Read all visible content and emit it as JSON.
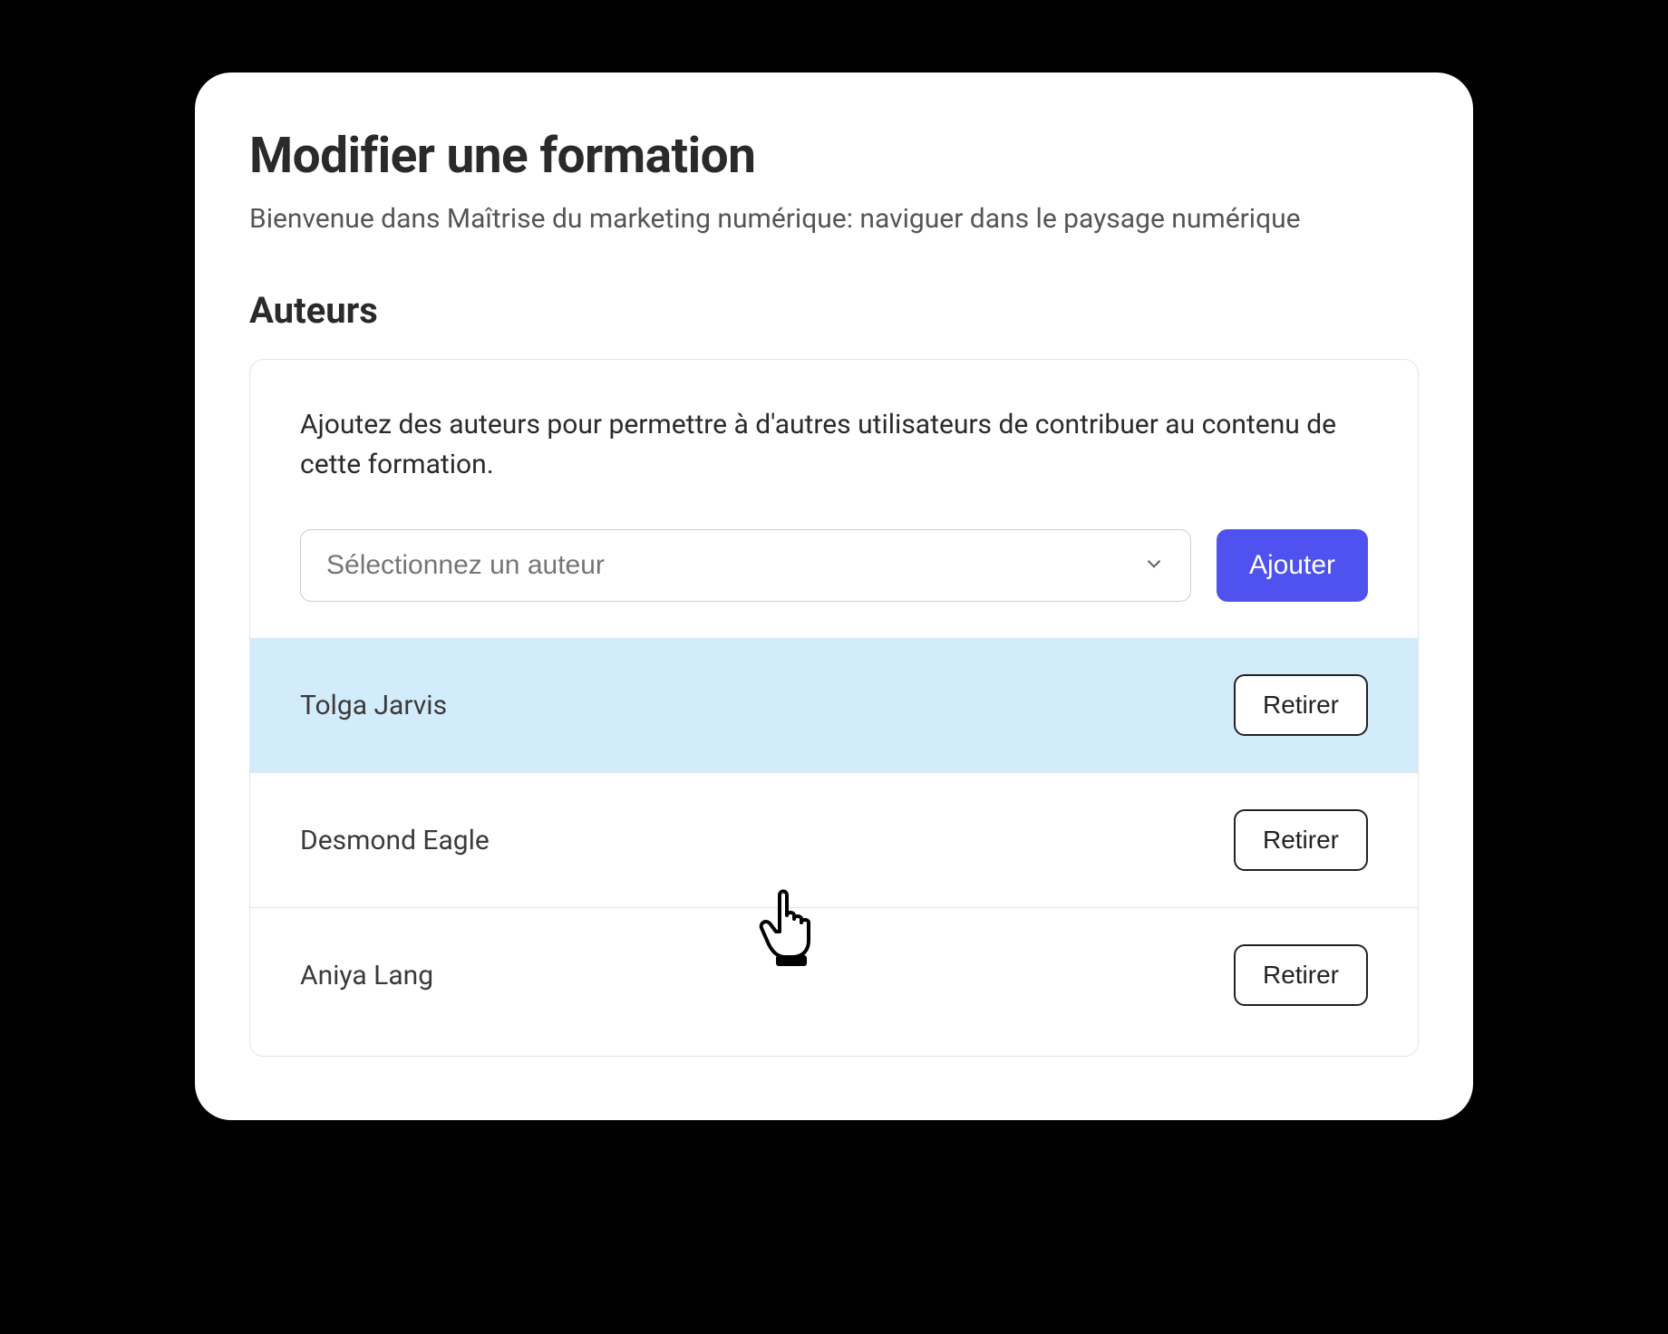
{
  "page": {
    "title": "Modifier une formation",
    "subtitle": "Bienvenue dans Maîtrise du marketing numérique: naviguer dans le paysage numérique"
  },
  "authors": {
    "section_title": "Auteurs",
    "help_text": "Ajoutez des auteurs pour permettre à d'autres utilisateurs de contribuer au contenu de cette formation.",
    "select_placeholder": "Sélectionnez un auteur",
    "add_label": "Ajouter",
    "remove_label": "Retirer",
    "list": [
      {
        "name": "Tolga Jarvis"
      },
      {
        "name": "Desmond Eagle"
      },
      {
        "name": "Aniya Lang"
      }
    ]
  }
}
